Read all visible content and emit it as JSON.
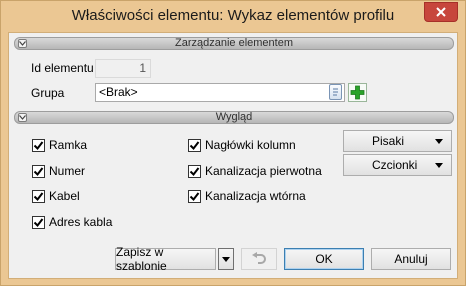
{
  "window": {
    "title": "Właściwości elementu: Wykaz elementów profilu",
    "frame_color": "#ebc793",
    "close_color": "#c7463c"
  },
  "section_management": {
    "label": "Zarządzanie elementem",
    "id_label": "Id elementu",
    "id_value": "1",
    "group_label": "Grupa",
    "group_value": "<Brak>",
    "group_icon": "document-icon",
    "add_icon": "plus-icon"
  },
  "section_appearance": {
    "label": "Wygląd",
    "checkboxes_left": [
      {
        "label": "Ramka",
        "checked": true
      },
      {
        "label": "Numer",
        "checked": true
      },
      {
        "label": "Kabel",
        "checked": true
      },
      {
        "label": "Adres kabla",
        "checked": true
      }
    ],
    "checkboxes_right": [
      {
        "label": "Nagłówki kolumn",
        "checked": true
      },
      {
        "label": "Kanalizacja pierwotna",
        "checked": true
      },
      {
        "label": "Kanalizacja wtórna",
        "checked": true
      }
    ],
    "pens_button": "Pisaki",
    "fonts_button": "Czcionki"
  },
  "footer": {
    "save_template": "Zapisz w szablonie",
    "undo_icon": "undo-icon",
    "ok": "OK",
    "cancel": "Anuluj"
  }
}
